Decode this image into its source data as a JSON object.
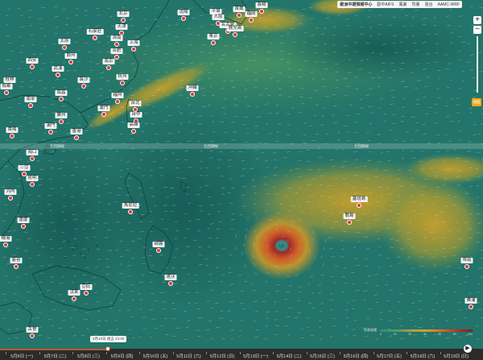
{
  "toolbar": {
    "items": [
      "歐洲中期預報中心",
      "歐中AIFS",
      "風暴",
      "烈暴",
      "混合",
      "AAMC-WRF"
    ],
    "active_index": 0
  },
  "zoom": {
    "in_label": "+",
    "out_label": "−"
  },
  "level_selector": {
    "label": "地面"
  },
  "latitude_labels": [
    "北回歸線",
    "北回歸線",
    "北回歸線"
  ],
  "cities": [
    {
      "name": "北京"
    },
    {
      "name": "天津"
    },
    {
      "name": "沈陽"
    },
    {
      "name": "平壤"
    },
    {
      "name": "首爾"
    },
    {
      "name": "石家莊"
    },
    {
      "name": "濟南"
    },
    {
      "name": "太原"
    },
    {
      "name": "鄭州"
    },
    {
      "name": "合肥"
    },
    {
      "name": "南京"
    },
    {
      "name": "上海"
    },
    {
      "name": "杭州"
    },
    {
      "name": "武漢"
    },
    {
      "name": "西安"
    },
    {
      "name": "長沙"
    },
    {
      "name": "南昌"
    },
    {
      "name": "福州"
    },
    {
      "name": "台北"
    },
    {
      "name": "台中"
    },
    {
      "name": "高雄"
    },
    {
      "name": "廈門"
    },
    {
      "name": "廣州"
    },
    {
      "name": "香港"
    },
    {
      "name": "澳門"
    },
    {
      "name": "南寧"
    },
    {
      "name": "海口"
    },
    {
      "name": "三亞"
    },
    {
      "name": "河內"
    },
    {
      "name": "桂林"
    },
    {
      "name": "貴陽"
    },
    {
      "name": "昆明"
    },
    {
      "name": "成都"
    },
    {
      "name": "重慶"
    },
    {
      "name": "沖繩"
    },
    {
      "name": "大阪"
    },
    {
      "name": "名古屋"
    },
    {
      "name": "東京"
    },
    {
      "name": "長崎"
    },
    {
      "name": "福岡"
    },
    {
      "name": "鹿兒島"
    },
    {
      "name": "馬尼拉"
    },
    {
      "name": "宿霧"
    },
    {
      "name": "達沃"
    },
    {
      "name": "汶萊"
    },
    {
      "name": "亞庇"
    },
    {
      "name": "古晉"
    },
    {
      "name": "峴港"
    },
    {
      "name": "西貢"
    },
    {
      "name": "曼谷"
    },
    {
      "name": "塞班島"
    },
    {
      "name": "關島"
    },
    {
      "name": "帛琉"
    },
    {
      "name": "雅浦"
    }
  ],
  "legend": {
    "title": "低層風速",
    "ticks": [
      "0",
      "10",
      "20",
      "30",
      "40",
      "50",
      "m/s"
    ]
  },
  "time_tip": "5月10日 週五 23:00",
  "timeline": {
    "progress": 0.22,
    "days": [
      "5月6日 (一)",
      "5月7日 (二)",
      "5月8日 (三)",
      "5月9日 (四)",
      "5月10日 (五)",
      "5月11日 (六)",
      "5月12日 (日)",
      "5月13日 (一)",
      "5月14日 (二)",
      "5月15日 (三)",
      "5月16日 (四)",
      "5月17日 (五)",
      "5月18日 (六)",
      "5月19日 (日)"
    ]
  },
  "play_icon": "play-icon"
}
